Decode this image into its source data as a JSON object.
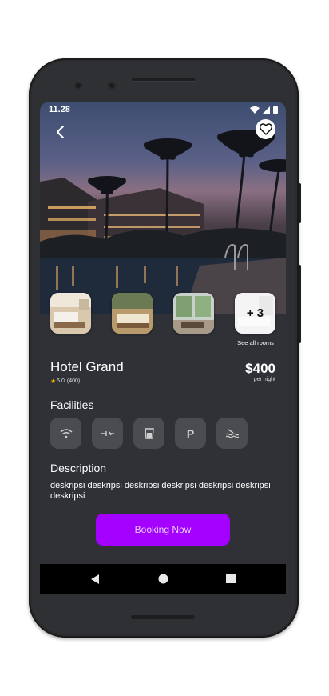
{
  "status_bar": {
    "time": "11.28"
  },
  "hotel": {
    "name": "Hotel Grand",
    "rating": "5.0",
    "reviews": "(400)",
    "price": "$400",
    "price_unit": "per night"
  },
  "gallery": {
    "more_count": "+ 3",
    "see_all_label": "See all rooms"
  },
  "facilities": {
    "title": "Facilities",
    "items": [
      "wifi-icon",
      "ac-icon",
      "drink-icon",
      "parking-icon",
      "pool-icon"
    ],
    "parking_letter": "P"
  },
  "description": {
    "title": "Description",
    "text": "deskripsi deskripsi deskripsi deskripsi deskripsi deskripsi deskripsi"
  },
  "actions": {
    "booking_label": "Booking Now"
  },
  "colors": {
    "accent": "#a300ff",
    "background": "#2f3136",
    "chip": "#4a4c50",
    "star": "#f5b400"
  }
}
